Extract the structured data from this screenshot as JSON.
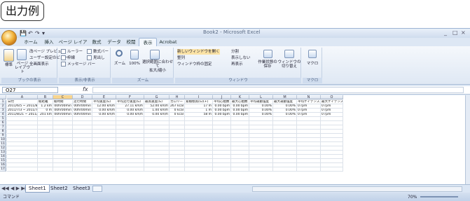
{
  "caption": "出力例",
  "window": {
    "title": "Book2 - Microsoft Excel",
    "controls": [
      "_",
      "□",
      "×"
    ],
    "qat": [
      "💾",
      "↶",
      "↷",
      "▾"
    ]
  },
  "ribbon_tabs": [
    "ホーム",
    "挿入",
    "ページ レイアウト",
    "数式",
    "データ",
    "校閲",
    "表示",
    "Acrobat"
  ],
  "active_tab_index": 6,
  "ribbon": {
    "g1": {
      "label": "ブックの表示",
      "normal": "標準",
      "page_layout": "ページ\nレイアウト",
      "items": [
        "改ページ プレビュー",
        "ユーザー設定のビュー",
        "全画面表示"
      ]
    },
    "g2": {
      "label": "表示/非表示",
      "items": [
        "ルーラー",
        "枠線",
        "メッセージ バー",
        "数式バー",
        "見出し"
      ]
    },
    "g3": {
      "label": "ズーム",
      "zoom": "ズーム",
      "hundred": "100%",
      "selection": "選択範囲に合わせて\n拡大/縮小"
    },
    "g4": {
      "label": "ウィンドウ",
      "items": [
        "新しいウィンドウを開く",
        "整列",
        "ウィンドウ枠の固定"
      ],
      "items2": [
        "分割",
        "表示しない",
        "再表示"
      ],
      "save": "作業状態の\n保存",
      "switch": "ウィンドウの\n切り替え"
    },
    "g5": {
      "label": "マクロ",
      "macro": "マクロ"
    }
  },
  "formula_bar": {
    "cell_ref": "O27",
    "fx": "fx",
    "value": ""
  },
  "columns": [
    "A",
    "B",
    "C",
    "D",
    "E",
    "F",
    "G",
    "H",
    "I",
    "J",
    "K",
    "L",
    "M",
    "N",
    "O"
  ],
  "selected_column": "C",
  "row_numbers": [
    "1",
    "2",
    "3",
    "4",
    "5",
    "6",
    "7",
    "8",
    "9",
    "10",
    "11",
    "12",
    "13",
    "14",
    "15",
    "16",
    "17"
  ],
  "headers": [
    "日付",
    "総距離",
    "総時間",
    "走行時間",
    "平均速度(G)",
    "平均走行速度(G)",
    "最高速度(G)",
    "カロリー",
    "累積標高(G)(+)",
    "平均心拍数",
    "最大心拍数",
    "平均運動強度",
    "最大運動強度",
    "平均ケイデンス",
    "最大ケイデンス"
  ],
  "rows": [
    [
      "2011/6/5 ~ 2011/8/11",
      "1.2 km",
      "00hr00min",
      "00hr00min",
      "12.00 km/h",
      "27.11 km/h",
      "52.00 km/h",
      "267 kcal",
      "17 m",
      "0.00 bpm",
      "0.00 bpm",
      "0.00%",
      "0.00%",
      "0 rpm",
      "0 rpm"
    ],
    [
      "2011/7/3 ~ 2011/7/8",
      "0 m",
      "00hr00min",
      "00hr00min",
      "0.00 km/h",
      "0.00 km/h",
      "1.00 km/h",
      "0 kcal",
      "1 m",
      "0.00 bpm",
      "0.00 bpm",
      "0.00%",
      "0.00%",
      "0 rpm",
      "0 rpm"
    ],
    [
      "2011/8/21 ~ 2011/8/27",
      "201 km",
      "00hr00min",
      "00hr00min",
      "0.00 km/h",
      "0.00 km/h",
      "0.00 km/h",
      "0 kcal",
      "58 m",
      "0.00 bpm",
      "0.00 bpm",
      "0.00%",
      "0.00%",
      "0 rpm",
      "0 rpm"
    ]
  ],
  "sheets": [
    "Sheet1",
    "Sheet2",
    "Sheet3"
  ],
  "active_sheet": "Sheet1",
  "status": {
    "mode": "コマンド",
    "zoom": "70%"
  }
}
